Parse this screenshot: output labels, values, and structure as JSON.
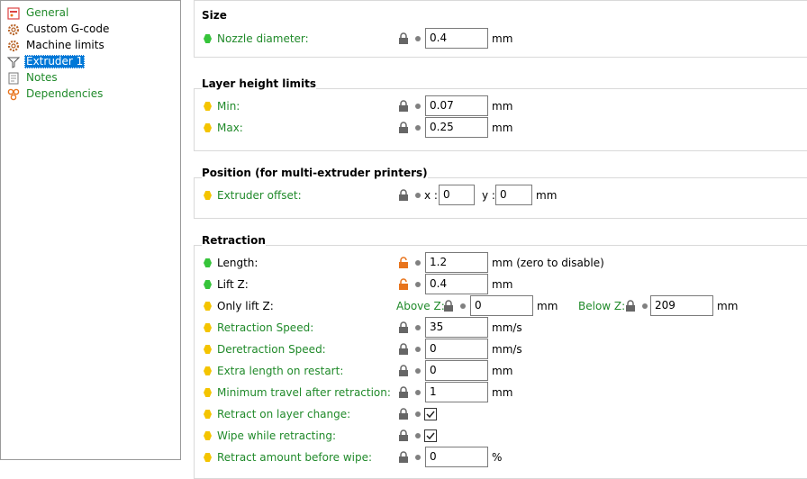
{
  "sidebar": {
    "items": [
      {
        "label": "General",
        "icon": "general-icon"
      },
      {
        "label": "Custom G-code",
        "icon": "gear-icon"
      },
      {
        "label": "Machine limits",
        "icon": "gear-icon"
      },
      {
        "label": "Extruder 1",
        "icon": "funnel-icon",
        "selected": true
      },
      {
        "label": "Notes",
        "icon": "notes-icon"
      },
      {
        "label": "Dependencies",
        "icon": "dependencies-icon"
      }
    ]
  },
  "size": {
    "title": "Size",
    "nozzle": {
      "label": "Nozzle diameter:",
      "value": "0.4",
      "unit": "mm"
    }
  },
  "layer_height": {
    "title": "Layer height limits",
    "min": {
      "label": "Min:",
      "value": "0.07",
      "unit": "mm"
    },
    "max": {
      "label": "Max:",
      "value": "0.25",
      "unit": "mm"
    }
  },
  "position": {
    "title": "Position (for multi-extruder printers)",
    "offset": {
      "label": "Extruder offset:",
      "x_label": "x :",
      "x_value": "0",
      "y_label": "y :",
      "y_value": "0",
      "unit": "mm"
    }
  },
  "retraction": {
    "title": "Retraction",
    "length": {
      "label": "Length:",
      "value": "1.2",
      "unit": "mm (zero to disable)"
    },
    "lift_z": {
      "label": "Lift Z:",
      "value": "0.4",
      "unit": "mm"
    },
    "only_lift_z": {
      "label": "Only lift Z:",
      "above_label": "Above Z:",
      "above_value": "0",
      "above_unit": "mm",
      "below_label": "Below Z:",
      "below_value": "209",
      "below_unit": "mm"
    },
    "speed": {
      "label": "Retraction Speed:",
      "value": "35",
      "unit": "mm/s"
    },
    "deretraction": {
      "label": "Deretraction Speed:",
      "value": "0",
      "unit": "mm/s"
    },
    "extra_length": {
      "label": "Extra length on restart:",
      "value": "0",
      "unit": "mm"
    },
    "min_travel": {
      "label": "Minimum travel after retraction:",
      "value": "1",
      "unit": "mm"
    },
    "layer_change": {
      "label": "Retract on layer change:",
      "checked": true
    },
    "wipe": {
      "label": "Wipe while retracting:",
      "checked": true
    },
    "before_wipe": {
      "label": "Retract amount before wipe:",
      "value": "0",
      "unit": "%"
    }
  },
  "colors": {
    "system_value": "#208a2a",
    "modified_lock": "#e8741c",
    "highlight": "#f2f200",
    "selection": "#0078d7"
  }
}
